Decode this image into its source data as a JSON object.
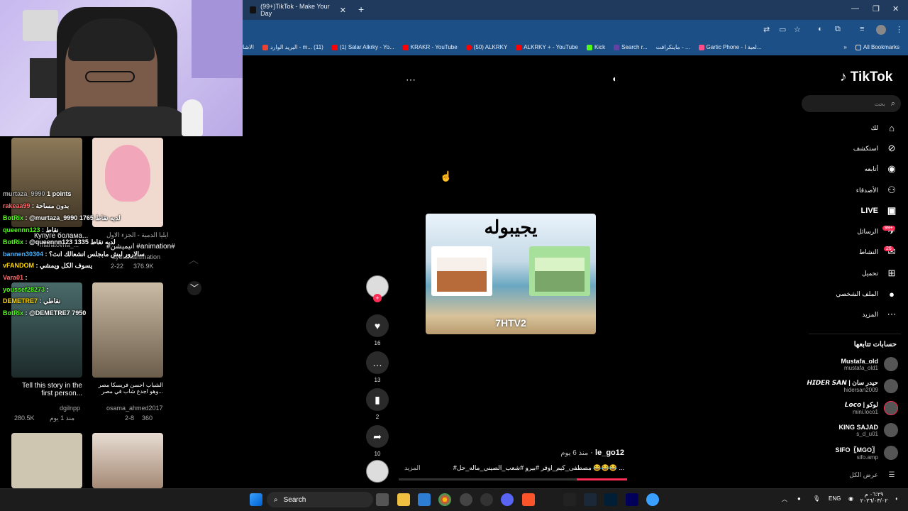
{
  "browser": {
    "tab_title": "(99+)TikTok - Make Your Day",
    "new_tab": "+",
    "close": "✕",
    "bookmarks": [
      {
        "label": "الاشا",
        "color": "#999999"
      },
      {
        "label": "البريد الوارد - m... (11)",
        "color": "#ea4335"
      },
      {
        "label": "(1) Salar Alkrky - Yo...",
        "color": "#ff0000"
      },
      {
        "label": "KRAKR - YouTube",
        "color": "#ff0000"
      },
      {
        "label": "(50) ALKRKY",
        "color": "#ff0000"
      },
      {
        "label": "ALKRKY + - YouTube",
        "color": "#ff0000"
      },
      {
        "label": "Kick",
        "color": "#53fc18"
      },
      {
        "label": "Search r...",
        "color": "#6441a5"
      },
      {
        "label": "ماينكرافت - ...",
        "color": "#444444"
      },
      {
        "label": "Gartic Phone - لعبة ا...",
        "color": "#ff4e8a"
      }
    ],
    "all_bookmarks": "All Bookmarks"
  },
  "feed": {
    "items": [
      {
        "caption": "Купуге болама...",
        "author": "maratovna_...",
        "stats": "ايليا الدمية - الجزء الاول"
      },
      {
        "caption": "#انيميشن #animation#",
        "author": "ayoubxanimation",
        "date": "2-22",
        "views": "376.9K"
      },
      {
        "caption": "Tell this story in the first person...",
        "author": "dgilnpp",
        "date": "منذ 1 يوم",
        "views": "280.5K"
      },
      {
        "caption": "الشباب احسن فريسكا مصر وهو اجدع شاب في مصر...",
        "author": "osama_ahmed2017",
        "date": "2-8",
        "views": "360"
      }
    ],
    "chat": [
      {
        "user": "murtaza_9990",
        "text": "1 points",
        "color": "#cccccc"
      },
      {
        "user": "rakeaa99",
        "text": "بدون مساحة",
        "color": "#ff6b6b"
      },
      {
        "user": "BotRix",
        "text": "@murtaza_9990 لديه نقاط 1765",
        "color": "#53fc18"
      },
      {
        "user": "queennn123",
        "text": "نقاط",
        "color": "#53fc18"
      },
      {
        "user": "BotRix",
        "text": "@queennn123 لديه نقاط 1335",
        "color": "#53fc18"
      },
      {
        "user": "bannen30304",
        "text": "سالارور ليش مابجلس انشعالك انث؟",
        "color": "#4ab3ff"
      },
      {
        "user": "vFANDOM",
        "text": "يسوف الكل ويمشي",
        "color": "#ffd700"
      },
      {
        "user": "Vara01",
        "text": "",
        "color": "#ff6b6b"
      },
      {
        "user": "youssef28273",
        "text": "",
        "color": "#53fc18"
      },
      {
        "user": "DEMETRE7",
        "text": "نقاطي",
        "color": "#ffd700"
      },
      {
        "user": "BotRix",
        "text": "@DEMETRE7 7950",
        "color": "#53fc18"
      }
    ]
  },
  "player": {
    "video_title": "يجيبوله",
    "video_brand": "7HTV2",
    "likes": "16",
    "comments": "13",
    "saves": "2",
    "shares": "10",
    "author": "le_go12",
    "time": "منذ 6 يوم",
    "caption": "#مصطفى_كيم_اوفر #بيرو #شعب_الصيني_ماله_حل 😂😂😂 ...",
    "more": "المزيد",
    "progress": 0.22
  },
  "sidebar": {
    "logo": "TikTok",
    "search_placeholder": "بحث",
    "nav": [
      {
        "label": "لك",
        "icon": "⌂"
      },
      {
        "label": "استكشف",
        "icon": "⊘"
      },
      {
        "label": "أتابعه",
        "icon": "◉"
      },
      {
        "label": "الأصدقاء",
        "icon": "⚇"
      },
      {
        "label": "LIVE",
        "icon": "▣"
      },
      {
        "label": "الرسائل",
        "icon": "✈",
        "badge": "99+"
      },
      {
        "label": "النشاط",
        "icon": "✉",
        "badge": "26"
      },
      {
        "label": "تحميل",
        "icon": "⊞"
      },
      {
        "label": "الملف الشخصي",
        "icon": "●"
      },
      {
        "label": "المزيد",
        "icon": "⋯"
      }
    ],
    "following_title": "حسابات تتابعها",
    "accounts": [
      {
        "name": "Mustafa_old",
        "handle": "mustafa_old1"
      },
      {
        "name": "𝙃𝙄𝘿𝙀𝙍 𝙎𝘼𝙉 | حيدر سان",
        "handle": "hidersan2009"
      },
      {
        "name": "𝙇𝙤𝙘𝙤 | لوكو",
        "handle": "mini.loco1"
      },
      {
        "name": "KING SAJAD",
        "handle": "s_d_u01"
      },
      {
        "name": "SIFO〖MGO〗",
        "handle": "sifo.amp"
      }
    ],
    "see_all": "عرض الكل"
  },
  "taskbar": {
    "search": "Search",
    "lang": "ENG",
    "time": "٠٦:٢٩ م",
    "date": "٢٠٢٦/٠٣/٠٢"
  }
}
